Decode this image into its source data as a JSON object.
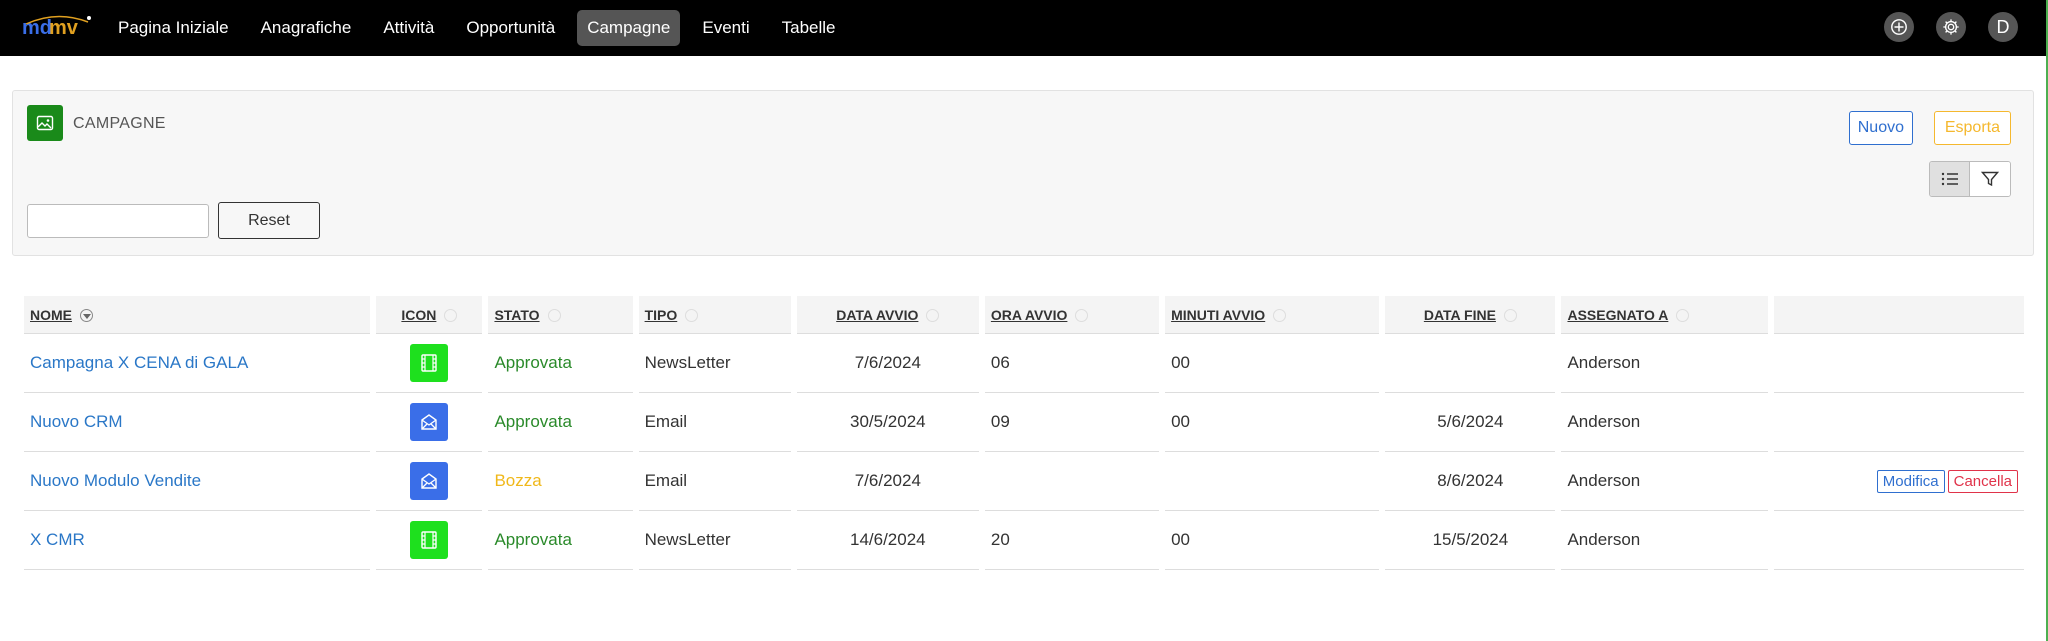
{
  "nav": {
    "logo_text": "mdmv",
    "items": [
      {
        "label": "Pagina Iniziale",
        "active": false
      },
      {
        "label": "Anagrafiche",
        "active": false
      },
      {
        "label": "Attività",
        "active": false
      },
      {
        "label": "Opportunità",
        "active": false
      },
      {
        "label": "Campagne",
        "active": true
      },
      {
        "label": "Eventi",
        "active": false
      },
      {
        "label": "Tabelle",
        "active": false
      }
    ],
    "add_icon": "plus-circle-icon",
    "settings_icon": "gear-icon",
    "user_initial": "D"
  },
  "panel": {
    "icon": "image-icon",
    "title": "CAMPAGNE",
    "new_label": "Nuovo",
    "export_label": "Esporta",
    "search_value": "",
    "reset_label": "Reset",
    "list_icon": "list-icon",
    "filter_icon": "filter-icon"
  },
  "table": {
    "headers": [
      "NOME",
      "ICON",
      "STATO",
      "TIPO",
      "DATA AVVIO",
      "ORA AVVIO",
      "MINUTI AVVIO",
      "DATA FINE",
      "ASSEGNATO A",
      ""
    ],
    "rows": [
      {
        "nome": "Campagna X CENA di GALA",
        "icon": "film-icon",
        "stato": "Approvata",
        "tipo": "NewsLetter",
        "data_avvio": "7/6/2024",
        "ora_avvio": "06",
        "minuti_avvio": "00",
        "data_fine": "",
        "assegnato": "Anderson",
        "modifica": "",
        "cancella": ""
      },
      {
        "nome": "Nuovo CRM",
        "icon": "mail-icon",
        "stato": "Approvata",
        "tipo": "Email",
        "data_avvio": "30/5/2024",
        "ora_avvio": "09",
        "minuti_avvio": "00",
        "data_fine": "5/6/2024",
        "assegnato": "Anderson",
        "modifica": "",
        "cancella": ""
      },
      {
        "nome": "Nuovo Modulo Vendite",
        "icon": "mail-icon",
        "stato": "Bozza",
        "tipo": "Email",
        "data_avvio": "7/6/2024",
        "ora_avvio": "",
        "minuti_avvio": "",
        "data_fine": "8/6/2024",
        "assegnato": "Anderson",
        "modifica": "Modifica",
        "cancella": "Cancella"
      },
      {
        "nome": "X CMR",
        "icon": "film-icon",
        "stato": "Approvata",
        "tipo": "NewsLetter",
        "data_avvio": "14/6/2024",
        "ora_avvio": "20",
        "minuti_avvio": "00",
        "data_fine": "15/5/2024",
        "assegnato": "Anderson",
        "modifica": "",
        "cancella": ""
      }
    ]
  },
  "colors": {
    "nav_bg": "#000000",
    "approved": "#2a8a2a",
    "draft": "#f0b81a",
    "link": "#2a77c7",
    "film_icon_bg": "#1ee01e",
    "mail_icon_bg": "#3a6ee8"
  }
}
